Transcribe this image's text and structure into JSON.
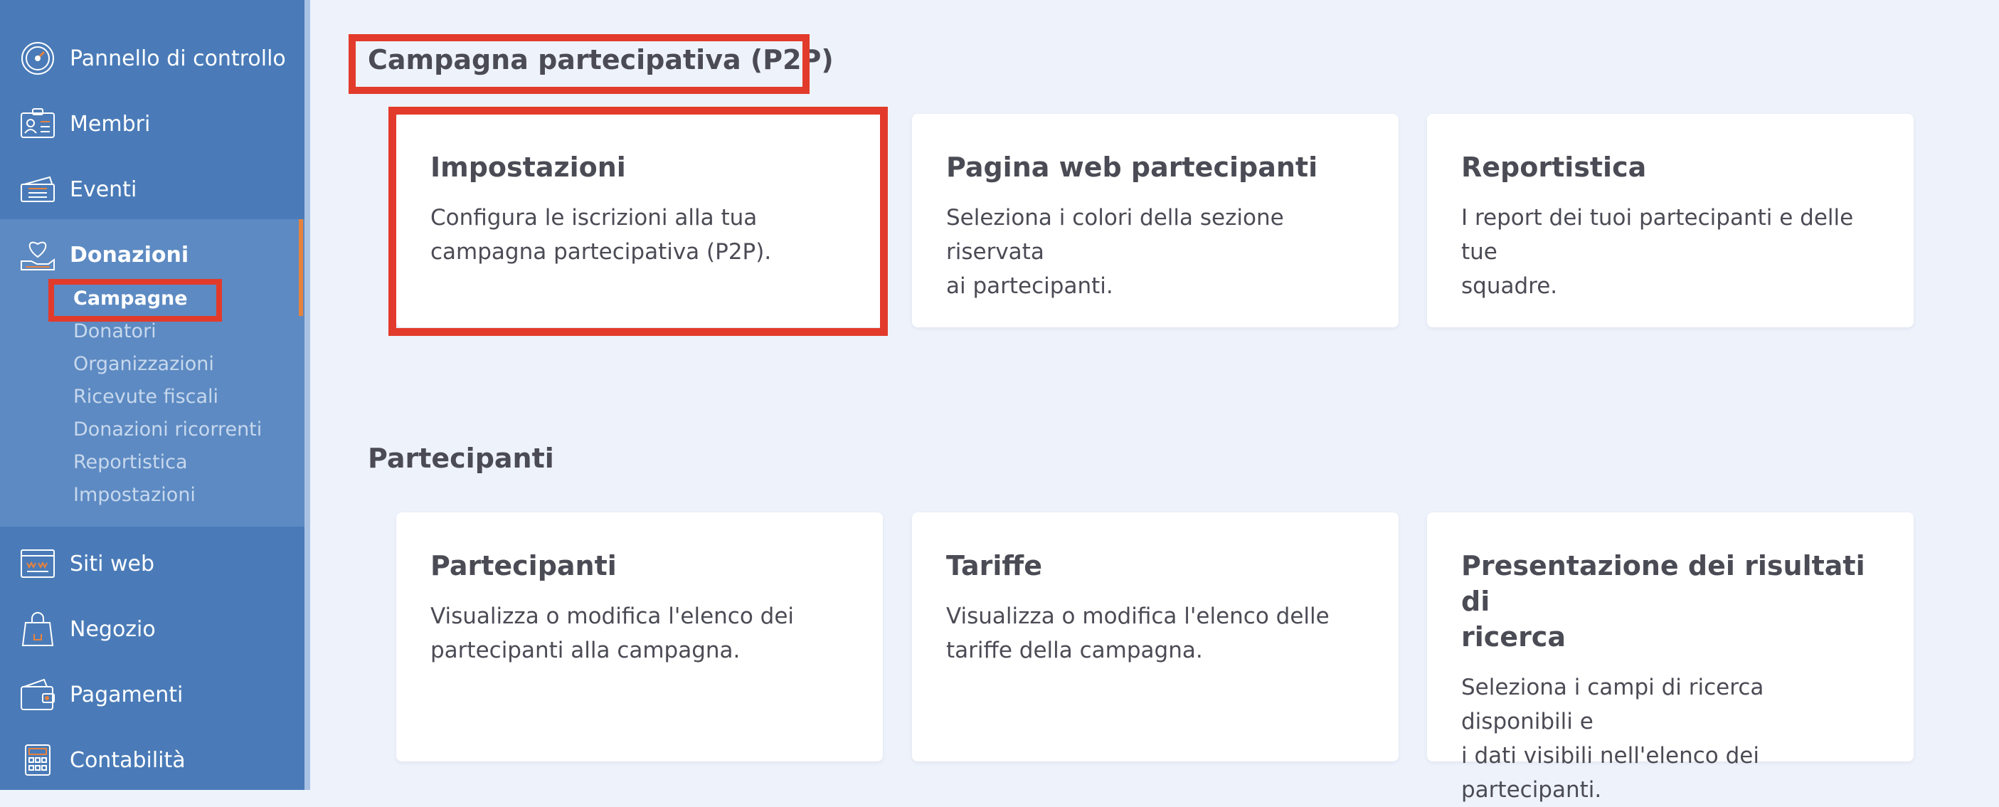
{
  "sidebar": {
    "items": [
      {
        "label": "Pannello di controllo",
        "icon": "speedometer-icon"
      },
      {
        "label": "Membri",
        "icon": "member-card-icon"
      },
      {
        "label": "Eventi",
        "icon": "tickets-icon"
      },
      {
        "label": "Donazioni",
        "icon": "heart-hand-icon"
      },
      {
        "label": "Siti web",
        "icon": "browser-window-icon"
      },
      {
        "label": "Negozio",
        "icon": "shopping-bag-icon"
      },
      {
        "label": "Pagamenti",
        "icon": "wallet-icon"
      },
      {
        "label": "Contabilità",
        "icon": "calculator-icon"
      }
    ],
    "donazioni_sub": [
      "Campagne",
      "Donatori",
      "Organizzazioni",
      "Ricevute fiscali",
      "Donazioni ricorrenti",
      "Reportistica",
      "Impostazioni"
    ],
    "active_sub": "Campagne"
  },
  "main": {
    "section1_title": "Campagna partecipativa (P2P)",
    "section1_cards": [
      {
        "title": "Impostazioni",
        "desc": [
          "Configura le iscrizioni alla tua",
          "campagna partecipativa (P2P)."
        ]
      },
      {
        "title": "Pagina web partecipanti",
        "desc": [
          "Seleziona i colori della sezione riservata",
          "ai partecipanti."
        ]
      },
      {
        "title": "Reportistica",
        "desc": [
          "I report dei tuoi partecipanti e delle tue",
          "squadre."
        ]
      }
    ],
    "section2_title": "Partecipanti",
    "section2_cards": [
      {
        "title": [
          "Partecipanti"
        ],
        "desc": [
          "Visualizza o modifica l'elenco dei",
          "partecipanti alla campagna."
        ]
      },
      {
        "title": [
          "Tariffe"
        ],
        "desc": [
          "Visualizza o modifica l'elenco delle",
          "tariffe della campagna."
        ]
      },
      {
        "title": [
          "Presentazione dei risultati di",
          "ricerca"
        ],
        "desc": [
          "Seleziona i campi di ricerca disponibili e",
          "i dati visibili nell'elenco dei partecipanti."
        ]
      }
    ]
  },
  "colors": {
    "sidebar": "#4a7bb8",
    "sidebar_section": "#5d8ac2",
    "accent": "#e7823c",
    "highlight": "#e23b2b",
    "background": "#eef2fb",
    "text": "#4b4b55"
  }
}
